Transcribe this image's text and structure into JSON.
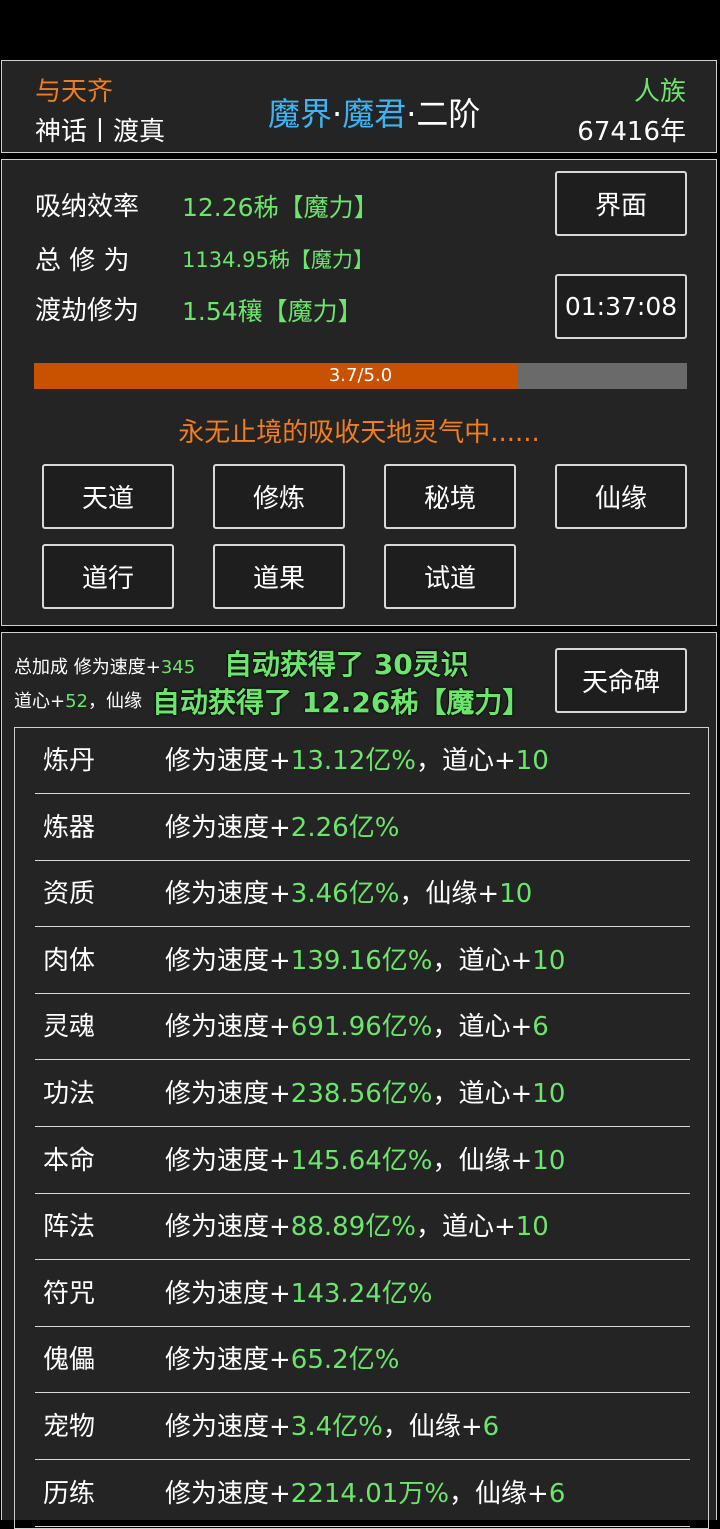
{
  "header": {
    "realm_name": "与天齐",
    "rank": "神话丨渡真",
    "title_part1": "魔界",
    "title_sep1": "·",
    "title_part2": "魔君",
    "title_sep2": "·",
    "title_part3": "二阶",
    "race": "人族",
    "age": "67416年"
  },
  "status": {
    "absorb_label": "吸纳效率",
    "absorb_value": "12.26秭【魔力】",
    "total_label": "总 修 为",
    "total_value": "1134.95秭【魔力】",
    "tribulation_label": "渡劫修为",
    "tribulation_value": "1.54穰【魔力】",
    "interface_button": "界面",
    "timer": "01:37:08",
    "progress_text": "3.7/5.0",
    "progress_fraction": 0.74,
    "message": "永无止境的吸收天地灵气中......",
    "buttons": [
      "天道",
      "修炼",
      "秘境",
      "仙缘",
      "道行",
      "道果",
      "试道"
    ]
  },
  "bonus": {
    "summary_line1_prefix": "总加成 修为速度+",
    "summary_line1_value": "345",
    "summary_line2_prefix": "道心+",
    "summary_line2_value": "52",
    "summary_line2_suffix": "，仙缘",
    "toast1": "自动获得了 30灵识",
    "toast2": "自动获得了 12.26秭【魔力】",
    "tianming_button": "天命碑",
    "rows": [
      {
        "name": "炼丹",
        "label": "修为速度+",
        "value": "13.12亿%",
        "sep": "，道心+",
        "extra": "10"
      },
      {
        "name": "炼器",
        "label": "修为速度+",
        "value": "2.26亿%",
        "sep": "",
        "extra": ""
      },
      {
        "name": "资质",
        "label": "修为速度+",
        "value": "3.46亿%",
        "sep": "，仙缘+",
        "extra": "10"
      },
      {
        "name": "肉体",
        "label": "修为速度+",
        "value": "139.16亿%",
        "sep": "，道心+",
        "extra": "10"
      },
      {
        "name": "灵魂",
        "label": "修为速度+",
        "value": "691.96亿%",
        "sep": "，道心+",
        "extra": "6"
      },
      {
        "name": "功法",
        "label": "修为速度+",
        "value": "238.56亿%",
        "sep": "，道心+",
        "extra": "10"
      },
      {
        "name": "本命",
        "label": "修为速度+",
        "value": "145.64亿%",
        "sep": "，仙缘+",
        "extra": "10"
      },
      {
        "name": "阵法",
        "label": "修为速度+",
        "value": "88.89亿%",
        "sep": "，道心+",
        "extra": "10"
      },
      {
        "name": "符咒",
        "label": "修为速度+",
        "value": "143.24亿%",
        "sep": "",
        "extra": ""
      },
      {
        "name": "傀儡",
        "label": "修为速度+",
        "value": "65.2亿%",
        "sep": "",
        "extra": ""
      },
      {
        "name": "宠物",
        "label": "修为速度+",
        "value": "3.4亿%",
        "sep": "，仙缘+",
        "extra": "6"
      },
      {
        "name": "历练",
        "label": "修为速度+",
        "value": "2214.01万%",
        "sep": "，仙缘+",
        "extra": "6"
      }
    ]
  },
  "colors": {
    "accent_orange": "#f07d1e",
    "value_green": "#6be56b",
    "title_blue": "#3fb3f2",
    "progress_fill": "#c95200"
  }
}
